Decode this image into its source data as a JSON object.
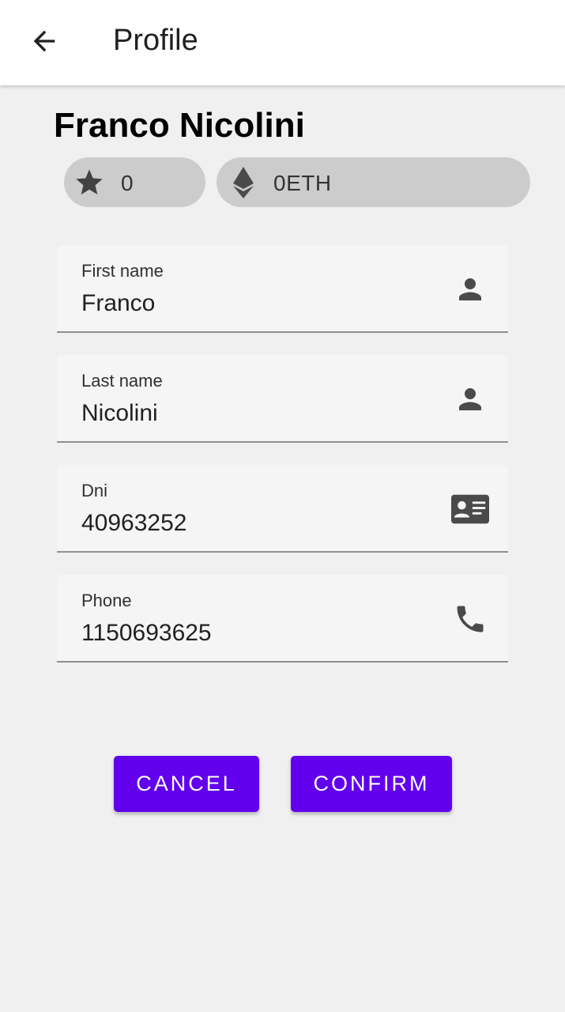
{
  "appbar": {
    "title": "Profile",
    "back_icon": "arrow-back-icon"
  },
  "profile": {
    "full_name": "Franco Nicolini",
    "rating": {
      "icon": "star-icon",
      "value": "0"
    },
    "balance": {
      "icon": "ethereum-icon",
      "value": "0ETH"
    }
  },
  "form": {
    "first_name": {
      "label": "First name",
      "value": "Franco",
      "icon": "person-icon"
    },
    "last_name": {
      "label": "Last name",
      "value": "Nicolini",
      "icon": "person-icon"
    },
    "dni": {
      "label": "Dni",
      "value": "40963252",
      "icon": "id-card-icon"
    },
    "phone": {
      "label": "Phone",
      "value": "1150693625",
      "icon": "phone-icon"
    }
  },
  "actions": {
    "cancel_label": "CANCEL",
    "confirm_label": "CONFIRM"
  },
  "colors": {
    "accent": "#6200ee",
    "chip_background": "#cccccc",
    "page_background": "#f0f0f0",
    "field_background": "#f5f5f5"
  }
}
